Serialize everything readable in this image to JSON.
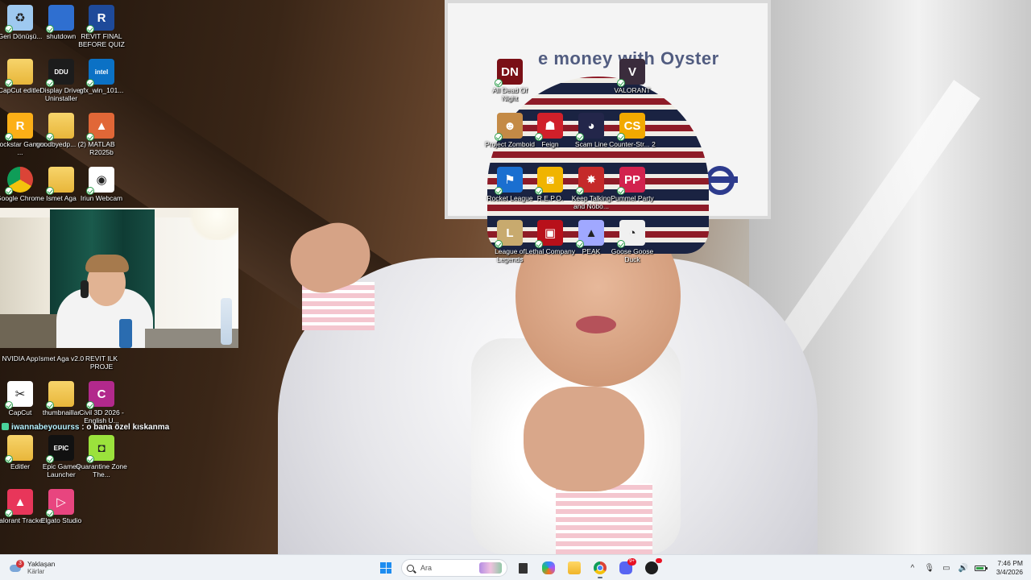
{
  "desktop": {
    "icons": [
      {
        "label": "Geri Dönüşü...",
        "icon": "recycle-bin-icon",
        "color": "#9ec9f0",
        "glyph": "♻"
      },
      {
        "label": "shutdown",
        "icon": "shutdown-window-icon",
        "color": "#2f6fd0",
        "glyph": ""
      },
      {
        "label": "REVIT FINAL BEFORE QUIZ",
        "icon": "revit-file-icon",
        "color": "#1e4a9a",
        "glyph": "R"
      },
      {
        "label": "CapCut editler",
        "icon": "folder-icon",
        "color": "#e8b63a",
        "glyph": ""
      },
      {
        "label": "Display Driver Uninstaller",
        "icon": "ddu-icon",
        "color": "#1c1c1c",
        "glyph": "DDU"
      },
      {
        "label": "gfx_win_101...",
        "icon": "intel-icon",
        "color": "#0b71c5",
        "glyph": "intel"
      },
      {
        "label": "Rockstar Games ...",
        "icon": "rockstar-icon",
        "color": "#fcaf17",
        "glyph": "R"
      },
      {
        "label": "goodbyedp... (2)",
        "icon": "folder-icon",
        "color": "#e8b63a",
        "glyph": ""
      },
      {
        "label": "MATLAB R2025b",
        "icon": "matlab-icon",
        "color": "#e16737",
        "glyph": "▲"
      },
      {
        "label": "Google Chrome",
        "icon": "chrome-icon",
        "color": "#4285f4",
        "glyph": ""
      },
      {
        "label": "Ismet Aga",
        "icon": "folder-icon",
        "color": "#e8b63a",
        "glyph": ""
      },
      {
        "label": "Iriun Webcam",
        "icon": "iriun-webcam-icon",
        "color": "#ffffff",
        "glyph": "◉"
      },
      {
        "label": "NVIDIA App",
        "icon": "nvidia-icon",
        "color": "#76b900",
        "glyph": ""
      },
      {
        "label": "Ismet Aga v2.0",
        "icon": "folder-icon",
        "color": "#e8b63a",
        "glyph": ""
      },
      {
        "label": "REVIT ILK PROJE",
        "icon": "revit-file-icon",
        "color": "#1e4a9a",
        "glyph": ""
      },
      {
        "label": "CapCut",
        "icon": "capcut-icon",
        "color": "#ffffff",
        "glyph": "✂"
      },
      {
        "label": "thumbnaillar",
        "icon": "folder-icon",
        "color": "#e8b63a",
        "glyph": ""
      },
      {
        "label": "Civil 3D 2026 - English U...",
        "icon": "civil3d-icon",
        "color": "#b2298c",
        "glyph": "C"
      },
      {
        "label": "Editler",
        "icon": "folder-icon",
        "color": "#e8b63a",
        "glyph": ""
      },
      {
        "label": "Epic Games Launcher",
        "icon": "epic-games-icon",
        "color": "#111111",
        "glyph": "EPIC"
      },
      {
        "label": "Quarantine Zone The...",
        "icon": "quarantine-zone-icon",
        "color": "#9be23c",
        "glyph": "◘"
      },
      {
        "label": "Valorant Tracker",
        "icon": "valorant-tracker-icon",
        "color": "#e8365a",
        "glyph": "▲"
      },
      {
        "label": "Elgato Studio",
        "icon": "elgato-studio-icon",
        "color": "#e8457f",
        "glyph": "▷"
      },
      {
        "label": "All Dead Of Night",
        "icon": "dead-of-night-icon",
        "color": "#7a0f16",
        "glyph": "DN"
      },
      {
        "label": "VALORANT",
        "icon": "valorant-icon",
        "color": "#3a2c3c",
        "glyph": "V"
      },
      {
        "label": "Project Zomboid",
        "icon": "project-zomboid-icon",
        "color": "#c48a46",
        "glyph": "☻"
      },
      {
        "label": "Feign",
        "icon": "feign-icon",
        "color": "#d0202a",
        "glyph": "☗"
      },
      {
        "label": "Scam Line",
        "icon": "scam-line-icon",
        "color": "#23264a",
        "glyph": "◕"
      },
      {
        "label": "Counter-Str... 2",
        "icon": "counter-strike-icon",
        "color": "#f2a900",
        "glyph": "CS"
      },
      {
        "label": "Rocket League",
        "icon": "rocket-league-icon",
        "color": "#1a6fd0",
        "glyph": "⚑"
      },
      {
        "label": "R.E.P.O.",
        "icon": "repo-icon",
        "color": "#f0b400",
        "glyph": "◙"
      },
      {
        "label": "Keep Talking and Nobo...",
        "icon": "keep-talking-icon",
        "color": "#c52a2a",
        "glyph": "✸"
      },
      {
        "label": "Pummel Party",
        "icon": "pummel-party-icon",
        "color": "#d2224e",
        "glyph": "PP"
      },
      {
        "label": "League of Legends",
        "icon": "league-of-legends-icon",
        "color": "#c8aa6e",
        "glyph": "L"
      },
      {
        "label": "Lethal Company",
        "icon": "lethal-company-icon",
        "color": "#b8101a",
        "glyph": "▣"
      },
      {
        "label": "PEAK",
        "icon": "peak-icon",
        "color": "#a0a8ff",
        "glyph": "▲"
      },
      {
        "label": "Goose Goose Duck",
        "icon": "goose-goose-duck-icon",
        "color": "#f0f0f0",
        "glyph": "◔"
      }
    ]
  },
  "wallpaper": {
    "sign_text": "e money with Oyster"
  },
  "chat": {
    "user": "iwannabeyouurss",
    "separator": " : ",
    "message": "o bana özel kıskanma"
  },
  "taskbar": {
    "weather_badge": "3",
    "weather_title": "Yaklaşan",
    "weather_sub": "Kärlar",
    "search_placeholder": "Ara",
    "discord_badge": "9+",
    "time": "7:46 PM",
    "date": "3/4/2026"
  }
}
